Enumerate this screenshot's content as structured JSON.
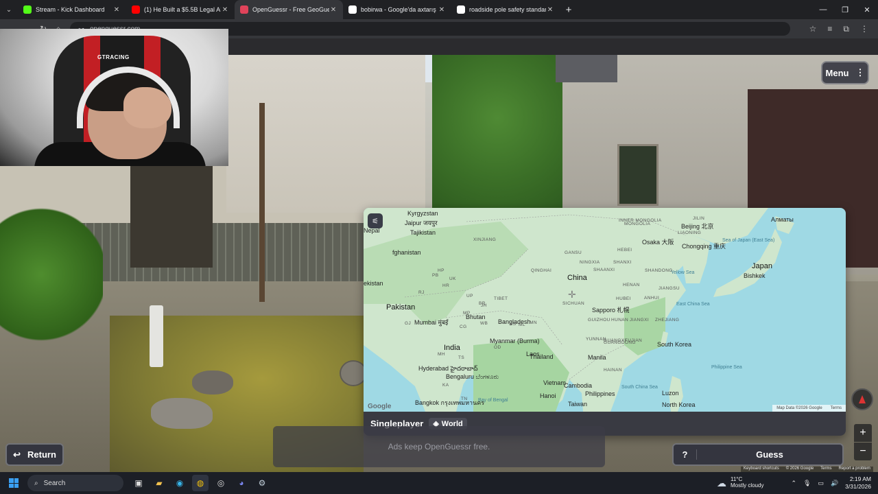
{
  "browser": {
    "tabs": [
      {
        "title": "Stream - Kick Dashboard",
        "active": false,
        "favicon": "kick-icon",
        "favicon_color": "#53fc18"
      },
      {
        "title": "(1) He Built a $5.5B Legal AI Co",
        "active": false,
        "favicon": "youtube-icon",
        "favicon_color": "#ff0000"
      },
      {
        "title": "OpenGuessr - Free GeoGuessr",
        "active": true,
        "favicon": "openguessr-icon",
        "favicon_color": "#e0435a"
      },
      {
        "title": "bobirwa - Google'da axtarış",
        "active": false,
        "favicon": "google-icon",
        "favicon_color": "#ffffff"
      },
      {
        "title": "roadside pole safety standards",
        "active": false,
        "favicon": "google-icon",
        "favicon_color": "#ffffff"
      }
    ],
    "url": "openguessr.com"
  },
  "webcam": {
    "chair_brand": "GTRACING"
  },
  "game": {
    "menu_label": "Menu",
    "mode_label": "Singleplayer",
    "map_badge": "World",
    "ad_text": "Ads keep OpenGuessr free.",
    "return_label": "Return",
    "guess_help": "?",
    "guess_label": "Guess",
    "map_attribution": "Map Data ©2026 Google",
    "map_terms": "Terms",
    "map_logo": "Google",
    "sv_attrib": [
      "Keyboard shortcuts",
      "© 2026 Google",
      "Terms",
      "Report a problem"
    ],
    "map_labels": {
      "big": [
        {
          "text": "China"
        },
        {
          "text": "India"
        },
        {
          "text": "Pakistan"
        },
        {
          "text": "Japan"
        }
      ],
      "mid": [
        {
          "text": "Kyrgyzstan"
        },
        {
          "text": "Tajikistan"
        },
        {
          "text": "fghanistan"
        },
        {
          "text": "ekistan"
        },
        {
          "text": "Nepal"
        },
        {
          "text": "Bhutan"
        },
        {
          "text": "Bangladesh"
        },
        {
          "text": "Myanmar (Burma)"
        },
        {
          "text": "Laos"
        },
        {
          "text": "Thailand"
        },
        {
          "text": "Vietnam"
        },
        {
          "text": "Cambodia"
        },
        {
          "text": "Philippines"
        },
        {
          "text": "Taiwan"
        },
        {
          "text": "North Korea"
        },
        {
          "text": "South Korea"
        },
        {
          "text": "Beijing 北京"
        },
        {
          "text": "Chongqing 重庆"
        },
        {
          "text": "Osaka 大阪"
        },
        {
          "text": "Sapporo 札幌"
        },
        {
          "text": "Bishkek"
        },
        {
          "text": "Алматы"
        },
        {
          "text": "Jaipur जयपुर"
        },
        {
          "text": "Mumbai मुंबई"
        },
        {
          "text": "Hyderabad హైదరాబాద్"
        },
        {
          "text": "Bengaluru ಬೆಂಗಳೂರು"
        },
        {
          "text": "Bangkok กรุงเทพมหานคร"
        },
        {
          "text": "Hanoi"
        },
        {
          "text": "Manila"
        },
        {
          "text": "Luzon"
        }
      ],
      "small": [
        {
          "text": "XINJIANG"
        },
        {
          "text": "TIBET"
        },
        {
          "text": "QINGHAI"
        },
        {
          "text": "GANSU"
        },
        {
          "text": "NINGXIA"
        },
        {
          "text": "SHAANXI"
        },
        {
          "text": "SHANXI"
        },
        {
          "text": "HENAN"
        },
        {
          "text": "HUBEI"
        },
        {
          "text": "SICHUAN"
        },
        {
          "text": "GUIZHOU"
        },
        {
          "text": "HUNAN"
        },
        {
          "text": "JIANGXI"
        },
        {
          "text": "YUNNAN"
        },
        {
          "text": "GUANGXI"
        },
        {
          "text": "GUANGDONG"
        },
        {
          "text": "FUJIAN"
        },
        {
          "text": "ZHEJIANG"
        },
        {
          "text": "JIANGSU"
        },
        {
          "text": "ANHUI"
        },
        {
          "text": "SHANDONG"
        },
        {
          "text": "HEBEI"
        },
        {
          "text": "INNER MONGOLIA"
        },
        {
          "text": "MONGOLIA"
        },
        {
          "text": "LIAONING"
        },
        {
          "text": "JILIN"
        },
        {
          "text": "HAINAN"
        },
        {
          "text": "UP"
        },
        {
          "text": "MP"
        },
        {
          "text": "OD"
        },
        {
          "text": "MH"
        },
        {
          "text": "TS"
        },
        {
          "text": "KA"
        },
        {
          "text": "TN"
        },
        {
          "text": "PB"
        },
        {
          "text": "HR"
        },
        {
          "text": "UK"
        },
        {
          "text": "RJ"
        },
        {
          "text": "GJ"
        },
        {
          "text": "BR"
        },
        {
          "text": "JH"
        },
        {
          "text": "WB"
        },
        {
          "text": "CG"
        },
        {
          "text": "AS"
        },
        {
          "text": "ML"
        },
        {
          "text": "MN"
        },
        {
          "text": "HP"
        }
      ],
      "sea": [
        {
          "text": "Sea of Japan (East Sea)"
        },
        {
          "text": "Yellow Sea"
        },
        {
          "text": "East China Sea"
        },
        {
          "text": "Philippine Sea"
        },
        {
          "text": "Bay of Bengal"
        },
        {
          "text": "South China Sea"
        }
      ]
    }
  },
  "taskbar": {
    "search_label": "Search",
    "temperature": "11°C",
    "weather": "Mostly cloudy",
    "time": "2:19 AM",
    "date": "3/31/2026"
  }
}
